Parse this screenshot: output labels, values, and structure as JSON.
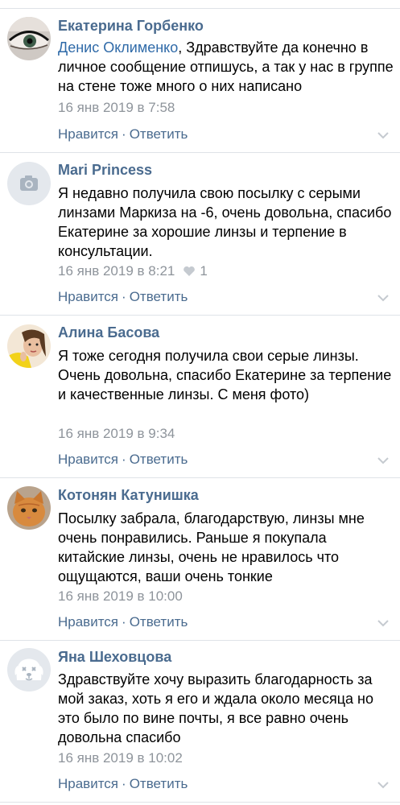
{
  "comments": [
    {
      "author": "Екатерина Горбенко",
      "reply_to": "Денис Оклименко",
      "text": ", Здравствуйте да конечно в личное сообщение отпишусь, а так у нас в группе на стене тоже много о них написано",
      "date": "16 янв 2019 в 7:58",
      "like_label": "Нравится",
      "separator": "·",
      "reply_label": "Ответить",
      "avatar": "woman-eye-makeup-photo"
    },
    {
      "author": "Mari Princess",
      "text": "Я недавно получила свою посылку с серыми линзами Маркиза на -6, очень довольна, спасибо Екатерине за хорошие линзы и терпение в консультации.",
      "date": "16 янв 2019 в 8:21",
      "likes": "1",
      "like_label": "Нравится",
      "separator": "·",
      "reply_label": "Ответить",
      "avatar": "camera-placeholder-icon"
    },
    {
      "author": "Алина Басова",
      "text": "Я тоже сегодня получила свои серые линзы. Очень довольна, спасибо Екатерине за терпение и качественные линзы. С меня фото)",
      "date": "16 янв 2019 в 9:34",
      "like_label": "Нравится",
      "separator": "·",
      "reply_label": "Ответить",
      "avatar": "woman-yellow-photo"
    },
    {
      "author": "Котонян Катунишка",
      "text": "Посылку забрала, благодарствую, линзы мне очень понравились. Раньше я покупала китайские линзы, очень не нравилось что ощущаются, ваши очень тонкие",
      "date": "16 янв 2019 в 10:00",
      "like_label": "Нравится",
      "separator": "·",
      "reply_label": "Ответить",
      "avatar": "ginger-cat-photo"
    },
    {
      "author": "Яна Шеховцова",
      "text": "Здравствуйте хочу выразить благодарность за мой заказ, хоть я его и ждала около месяца но это было по вине почты, я все равно очень довольна спасибо",
      "date": "16 янв 2019 в 10:02",
      "like_label": "Нравится",
      "separator": "·",
      "reply_label": "Ответить",
      "avatar": "deactivated-dog-icon"
    }
  ],
  "colors": {
    "author": "#4a6b8f",
    "link": "#2f6aa8",
    "meta": "#8e949b",
    "divider": "#dfe3e8"
  }
}
